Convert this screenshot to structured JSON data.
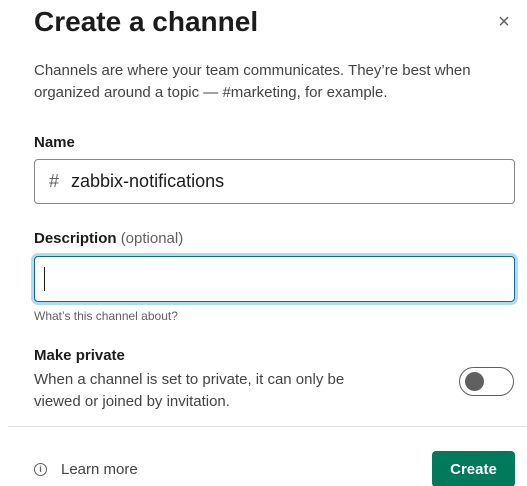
{
  "modal": {
    "title": "Create a channel",
    "close_glyph": "×",
    "intro": "Channels are where your team communicates. They’re best when organized around a topic — #marketing, for example."
  },
  "name": {
    "label": "Name",
    "prefix": "#",
    "value": "zabbix-notifications"
  },
  "description": {
    "label": "Description",
    "optional": "(optional)",
    "value": "",
    "hint": "What’s this channel about?"
  },
  "private": {
    "title": "Make private",
    "description": "When a channel is set to private, it can only be viewed or joined by invitation.",
    "enabled": false
  },
  "footer": {
    "info_glyph": "i",
    "learn_more": "Learn more",
    "create_label": "Create"
  },
  "colors": {
    "primary_button": "#007a5a",
    "focus_border": "#1264a3"
  },
  "icons": {
    "close": "close-icon",
    "info": "info-icon"
  }
}
